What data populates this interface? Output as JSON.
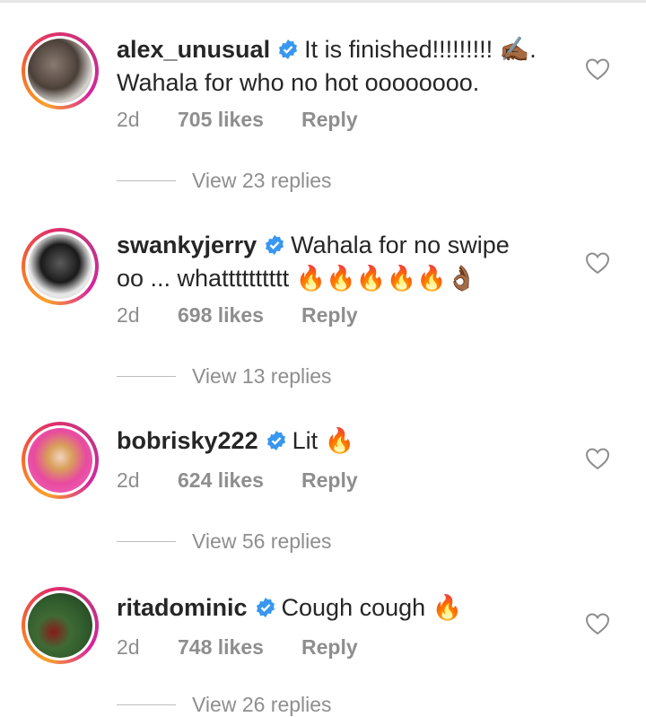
{
  "comments": [
    {
      "username": "alex_unusual",
      "text": "It is finished!!!!!!!!! ✍🏾. Wahala for who no hot oooooooo.",
      "time": "2d",
      "likes": "705 likes",
      "reply_label": "Reply",
      "view_replies": "View 23 replies"
    },
    {
      "username": "swankyjerry",
      "text": "Wahala for no swipe oo ... whatttttttttt 🔥🔥🔥🔥🔥👌🏾",
      "time": "2d",
      "likes": "698 likes",
      "reply_label": "Reply",
      "view_replies": "View 13 replies"
    },
    {
      "username": "bobrisky222",
      "text": "Lit 🔥",
      "time": "2d",
      "likes": "624 likes",
      "reply_label": "Reply",
      "view_replies": "View 56 replies"
    },
    {
      "username": "ritadominic",
      "text": "Cough cough 🔥",
      "time": "2d",
      "likes": "748 likes",
      "reply_label": "Reply",
      "view_replies": "View 26 replies"
    }
  ],
  "icons": {
    "verified": "verified-badge-icon",
    "like": "heart-outline-icon"
  },
  "colors": {
    "verified": "#3897f0",
    "meta_text": "#8e8e8e",
    "fire": "#f77b1c"
  }
}
